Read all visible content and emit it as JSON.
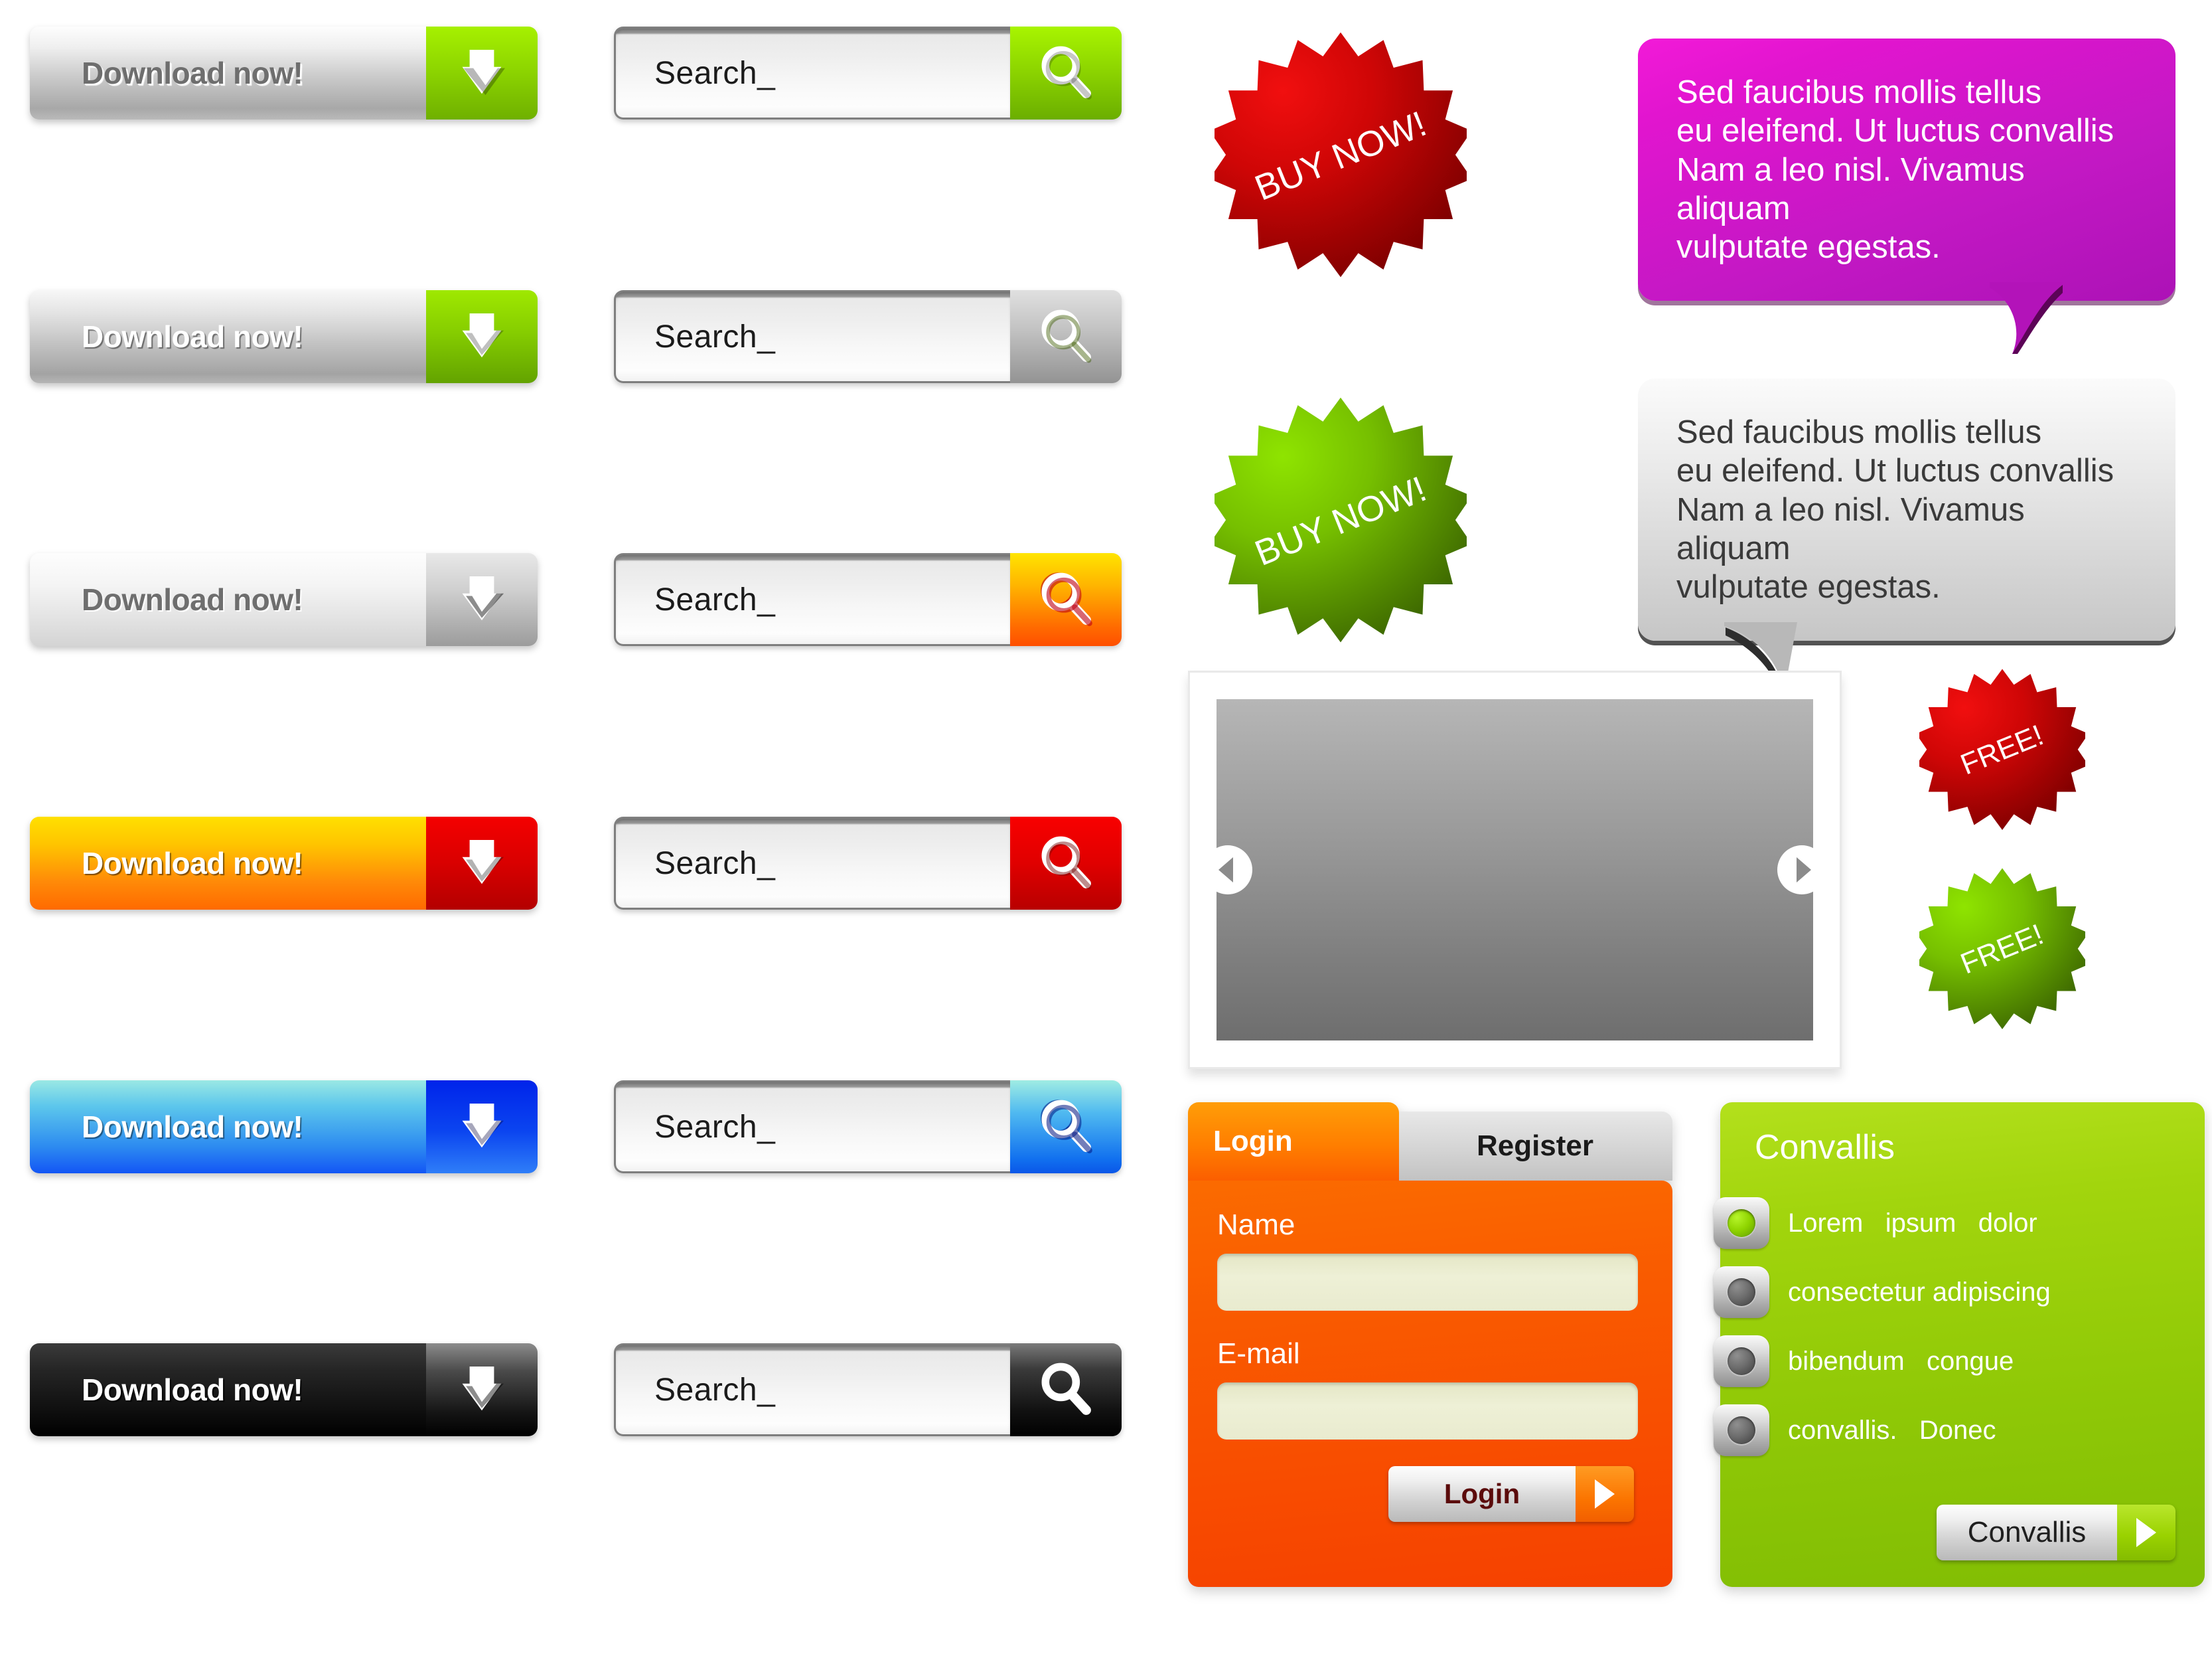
{
  "download_buttons": [
    {
      "label": "Download now!",
      "variant": "grey-green",
      "icon": "arrow-down-icon"
    },
    {
      "label": "Download now!",
      "variant": "grey-green-2",
      "icon": "arrow-down-icon"
    },
    {
      "label": "Download now!",
      "variant": "light-grey",
      "icon": "arrow-down-icon"
    },
    {
      "label": "Download now!",
      "variant": "orange-red",
      "icon": "arrow-down-icon"
    },
    {
      "label": "Download now!",
      "variant": "blue",
      "icon": "arrow-down-icon"
    },
    {
      "label": "Download now!",
      "variant": "black",
      "icon": "arrow-down-icon"
    }
  ],
  "search_boxes": [
    {
      "value": "Search_",
      "placeholder": "Search_",
      "accent": "#8ed600",
      "accent_name": "green",
      "icon": "magnifier-icon"
    },
    {
      "value": "Search_",
      "placeholder": "Search_",
      "accent": "#939393",
      "accent_name": "grey",
      "icon": "magnifier-icon"
    },
    {
      "value": "Search_",
      "placeholder": "Search_",
      "accent": "#ff6a00",
      "accent_name": "orange",
      "icon": "magnifier-icon"
    },
    {
      "value": "Search_",
      "placeholder": "Search_",
      "accent": "#d90000",
      "accent_name": "red",
      "icon": "magnifier-icon"
    },
    {
      "value": "Search_",
      "placeholder": "Search_",
      "accent": "#1170ef",
      "accent_name": "blue",
      "icon": "magnifier-icon"
    },
    {
      "value": "Search_",
      "placeholder": "Search_",
      "accent": "#111111",
      "accent_name": "black",
      "icon": "magnifier-icon"
    }
  ],
  "badges": [
    {
      "text": "BUY NOW!",
      "color": "#c40000",
      "size": "large",
      "shape": "starburst"
    },
    {
      "text": "BUY NOW!",
      "color": "#71a800",
      "size": "large",
      "shape": "starburst"
    },
    {
      "text": "FREE!",
      "color": "#c40000",
      "size": "small",
      "shape": "starburst"
    },
    {
      "text": "FREE!",
      "color": "#71a800",
      "size": "small",
      "shape": "starburst"
    }
  ],
  "speech_bubbles": [
    {
      "text": "Sed faucibus mollis tellus\neu eleifend. Ut luctus convallis\nNam a leo nisl. Vivamus aliquam\nvulputate egestas.",
      "color": "#d019c8",
      "theme": "magenta",
      "tail": "bottom-right"
    },
    {
      "text": "Sed faucibus mollis tellus\neu eleifend. Ut luctus convallis\nNam a leo nisl. Vivamus aliquam\nvulputate egestas.",
      "color": "#d5d5d5",
      "theme": "grey",
      "tail": "bottom-left"
    }
  ],
  "slider": {
    "prev_icon": "chevron-left-icon",
    "next_icon": "chevron-right-icon",
    "placeholder_color": "#8b8b8b"
  },
  "login_panel": {
    "tabs": [
      {
        "label": "Login",
        "active": true
      },
      {
        "label": "Register",
        "active": false
      }
    ],
    "fields": [
      {
        "label": "Name",
        "value": "",
        "placeholder": ""
      },
      {
        "label": "E-mail",
        "value": "",
        "placeholder": ""
      }
    ],
    "submit": {
      "label": "Login",
      "icon": "arrow-right-icon"
    },
    "accent": "#f84c00"
  },
  "convallis_panel": {
    "title": "Convallis",
    "accent": "#8fc806",
    "options": [
      {
        "label": "Lorem   ipsum   dolor",
        "selected": true
      },
      {
        "label": "consectetur adipiscing",
        "selected": false
      },
      {
        "label": "bibendum   congue",
        "selected": false
      },
      {
        "label": "convallis.   Donec",
        "selected": false
      }
    ],
    "submit": {
      "label": "Convallis",
      "icon": "arrow-right-icon"
    }
  }
}
